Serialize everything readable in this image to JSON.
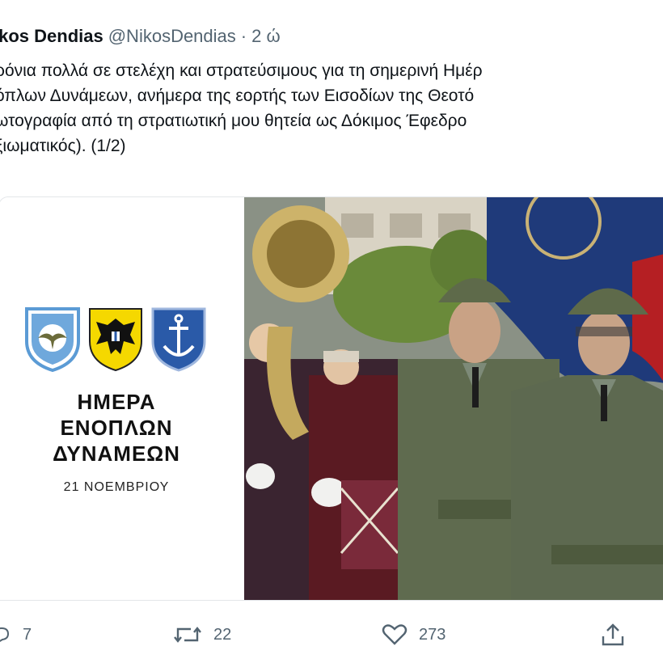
{
  "tweet": {
    "name": "ikos Dendias",
    "handle": "@NikosDendias",
    "separator": "·",
    "time": "2 ώ",
    "text_lines": [
      "ρόνια πολλά σε στελέχη και στρατεύσιμους για τη σημερινή Ημέρ",
      "όπλων Δυνάμεων, ανήμερα της εορτής των Εισοδίων της Θεοτό",
      "ωτογραφία από τη στρατιωτική μου θητεία ως Δόκιμος Έφεδρο",
      "ξιωματικός). (1/2)"
    ]
  },
  "media": {
    "left_panel": {
      "title_lines": [
        "ΗΜΕΡΑ",
        "ΕΝΟΠΛΩΝ",
        "ΔΥΝΑΜΕΩΝ"
      ],
      "date": "21 ΝΟΕΜΒΡΙΟΥ",
      "logo_icons": [
        "air-force-emblem-icon",
        "army-emblem-icon",
        "navy-emblem-icon"
      ]
    },
    "right_panel": {
      "icon": "ceremonial-parade-photo"
    }
  },
  "actions": {
    "reply": {
      "icon": "reply-icon",
      "count": "7"
    },
    "retweet": {
      "icon": "retweet-icon",
      "count": "22"
    },
    "like": {
      "icon": "heart-icon",
      "count": "273"
    },
    "share": {
      "icon": "share-icon"
    }
  },
  "colors": {
    "text": "#0f1419",
    "secondary_text": "#536471",
    "air_force_blue": "#5b9bd5",
    "army_yellow": "#f5d800",
    "navy_blue": "#2a5aa8",
    "uniform_olive": "#5f6b4f"
  }
}
